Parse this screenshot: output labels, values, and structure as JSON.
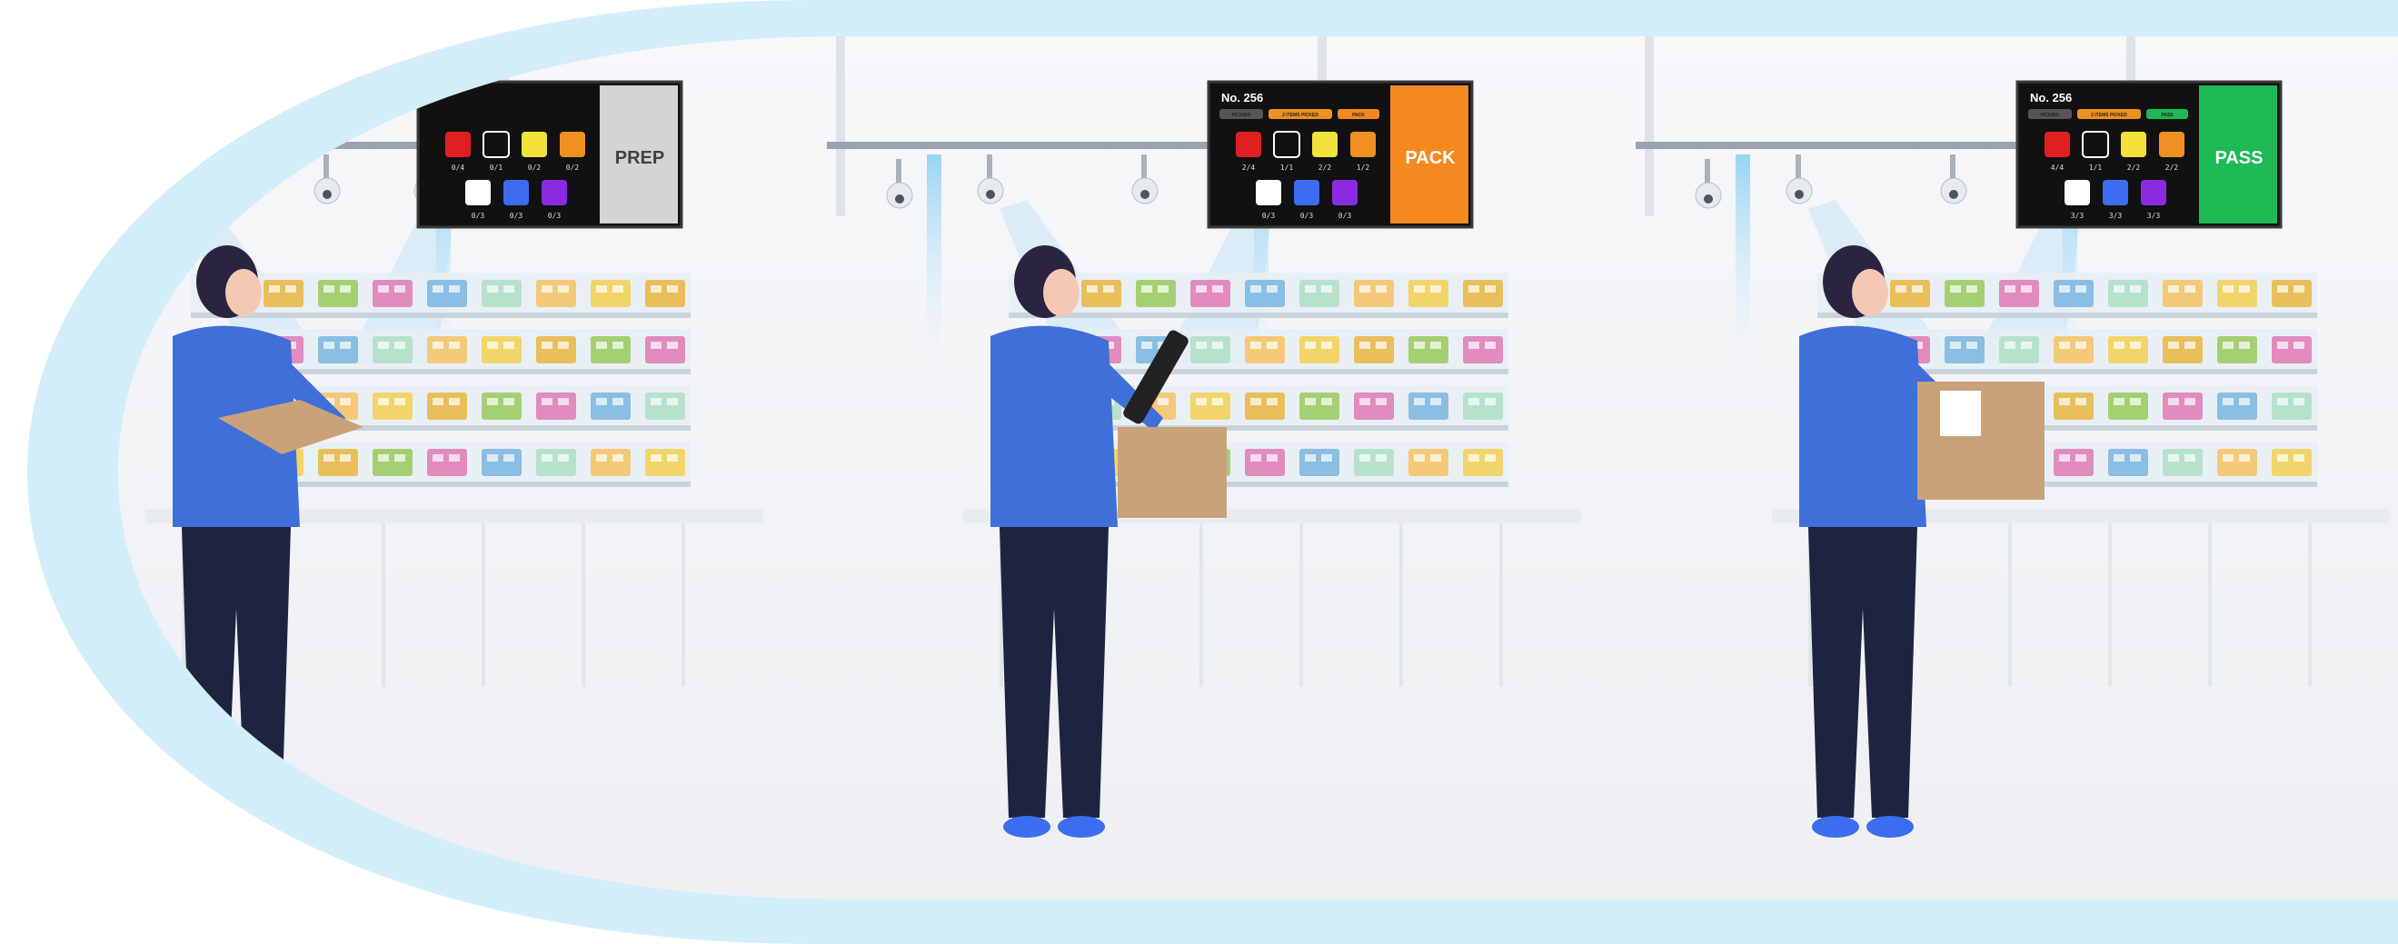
{
  "colors": {
    "outer_ring": "#d3eefb",
    "floor": "#f3f4f6",
    "shirt": "#3f6fd8",
    "pants": "#1e2440",
    "prep_panel": "#d4d4d4",
    "pack_panel": "#f5891f",
    "pass_panel": "#1db954",
    "light_beam": "#a9dcf5",
    "box": "#c9a27a"
  },
  "stations": [
    {
      "status": "PREP",
      "order_number": "",
      "tags": [],
      "top_counts": [
        "0/4",
        "0/1",
        "0/2",
        "0/2"
      ],
      "bottom_counts": [
        "0/3",
        "0/3",
        "0/3"
      ]
    },
    {
      "status": "PACK",
      "order_number": "No. 256",
      "tags": [
        "PICKING",
        "2 ITEMS PICKED",
        "PACK"
      ],
      "top_counts": [
        "2/4",
        "1/1",
        "2/2",
        "1/2"
      ],
      "bottom_counts": [
        "0/3",
        "0/3",
        "0/3"
      ]
    },
    {
      "status": "PASS",
      "order_number": "No. 256",
      "tags": [
        "PICKING",
        "2 ITEMS PICKED",
        "PASS"
      ],
      "top_counts": [
        "4/4",
        "1/1",
        "2/2",
        "2/2"
      ],
      "bottom_counts": [
        "3/3",
        "3/3",
        "3/3"
      ]
    }
  ],
  "slot_colors": [
    "#e02020",
    "#ffffff",
    "#f2e23a",
    "#f0901e",
    "#ffffff",
    "#3b6df0",
    "#8a2be2"
  ]
}
